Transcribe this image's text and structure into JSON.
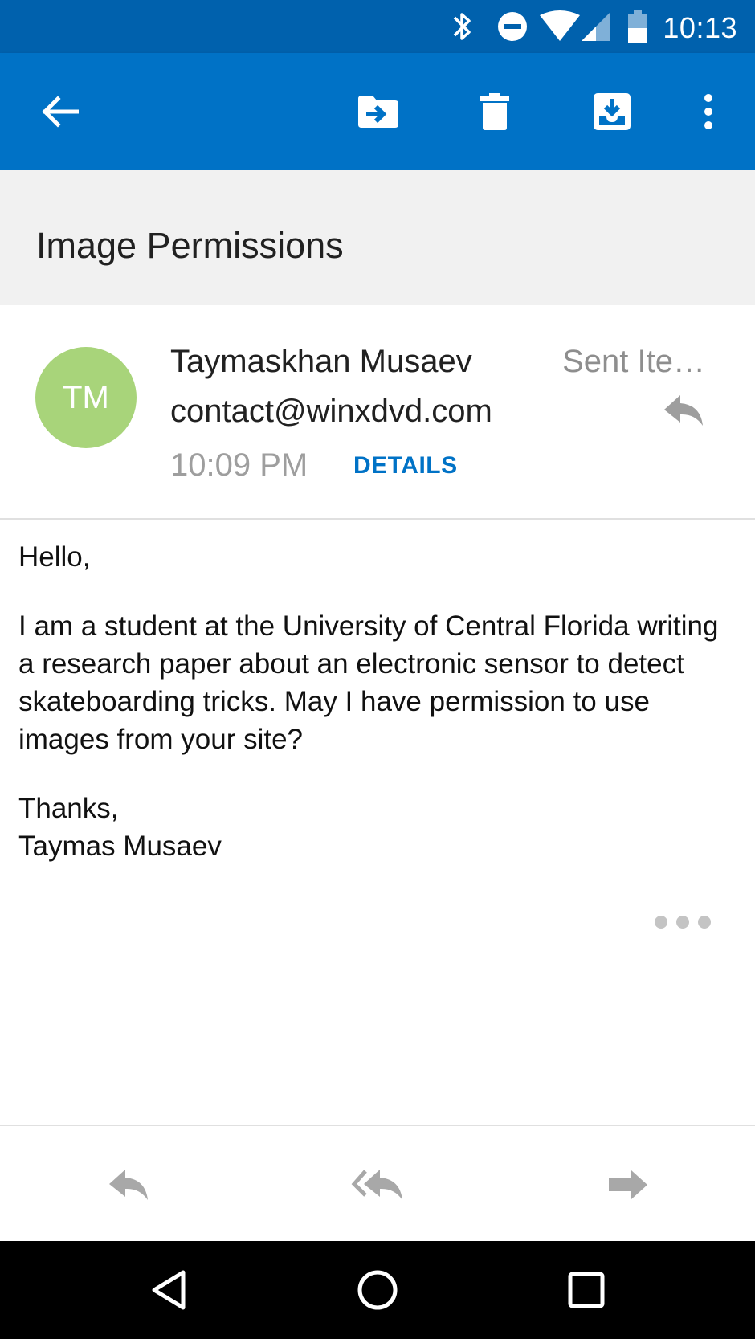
{
  "status_bar": {
    "time": "10:13",
    "icons": [
      "bluetooth-icon",
      "do-not-disturb-icon",
      "wifi-icon",
      "cell-signal-icon",
      "battery-icon"
    ]
  },
  "app_bar": {
    "actions": [
      "back-arrow-icon",
      "move-to-folder-icon",
      "delete-icon",
      "archive-icon",
      "more-options-icon"
    ],
    "color": "#0072c6"
  },
  "email": {
    "subject": "Image Permissions",
    "sender": {
      "initials": "TM",
      "name": "Taymaskhan Musaev",
      "email": "contact@winxdvd.com",
      "avatar_color": "#a8d47a"
    },
    "time": "10:09 PM",
    "details_label": "DETAILS",
    "folder": "Sent Ite…",
    "body": {
      "greeting": "Hello,",
      "paragraph": "I am a student at the University of Central Florida writing a research paper about an electronic sensor to detect skateboarding tricks. May I have permission to use images from your site?",
      "signoff_line1": "Thanks,",
      "signoff_line2": "Taymas Musaev"
    }
  },
  "bottom_actions": [
    "reply-icon",
    "reply-all-icon",
    "forward-icon"
  ],
  "nav_bar": [
    "back-triangle-icon",
    "home-circle-icon",
    "recents-square-icon"
  ]
}
